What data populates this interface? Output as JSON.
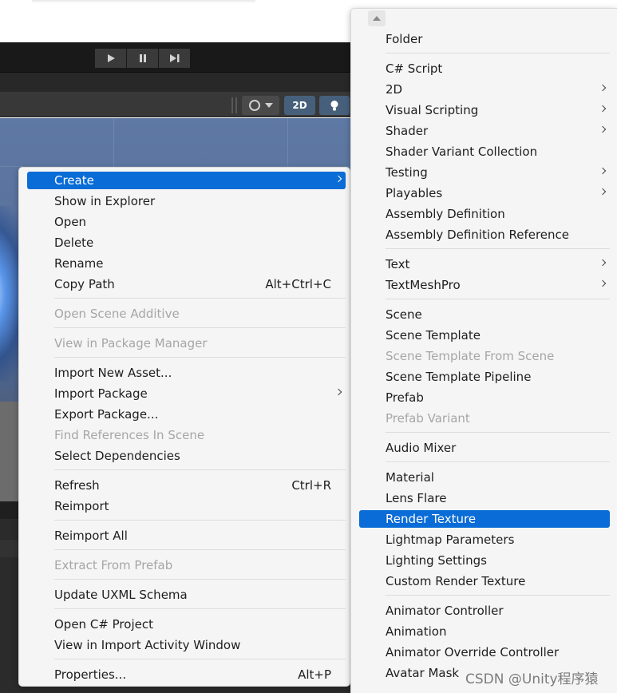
{
  "editor": {
    "play_icon": "play-icon",
    "pause_icon": "pause-icon",
    "step_icon": "step-icon",
    "view_2d_label": "2D",
    "gizmo_icon": "circle-gizmo-icon",
    "light_icon": "lightbulb-icon",
    "accent_color": "#46607c"
  },
  "context_menu": {
    "highlight_color": "#0a6cd6",
    "items": [
      {
        "label": "Create",
        "submenu": true,
        "highlighted": true
      },
      {
        "label": "Show in Explorer"
      },
      {
        "label": "Open"
      },
      {
        "label": "Delete"
      },
      {
        "label": "Rename"
      },
      {
        "label": "Copy Path",
        "shortcut": "Alt+Ctrl+C"
      },
      {
        "label": "Open Scene Additive",
        "disabled": true
      },
      {
        "label": "View in Package Manager",
        "disabled": true
      },
      {
        "label": "Import New Asset..."
      },
      {
        "label": "Import Package",
        "submenu": true
      },
      {
        "label": "Export Package..."
      },
      {
        "label": "Find References In Scene",
        "disabled": true
      },
      {
        "label": "Select Dependencies"
      },
      {
        "label": "Refresh",
        "shortcut": "Ctrl+R"
      },
      {
        "label": "Reimport"
      },
      {
        "label": "Reimport All"
      },
      {
        "label": "Extract From Prefab",
        "disabled": true
      },
      {
        "label": "Update UXML Schema"
      },
      {
        "label": "Open C# Project"
      },
      {
        "label": "View in Import Activity Window"
      },
      {
        "label": "Properties...",
        "shortcut": "Alt+P"
      }
    ]
  },
  "create_submenu": {
    "scroll_up_icon": "scroll-up-arrow-icon",
    "items": [
      {
        "label": "Folder"
      },
      {
        "label": "C# Script"
      },
      {
        "label": "2D",
        "submenu": true
      },
      {
        "label": "Visual Scripting",
        "submenu": true
      },
      {
        "label": "Shader",
        "submenu": true
      },
      {
        "label": "Shader Variant Collection"
      },
      {
        "label": "Testing",
        "submenu": true
      },
      {
        "label": "Playables",
        "submenu": true
      },
      {
        "label": "Assembly Definition"
      },
      {
        "label": "Assembly Definition Reference"
      },
      {
        "label": "Text",
        "submenu": true
      },
      {
        "label": "TextMeshPro",
        "submenu": true
      },
      {
        "label": "Scene"
      },
      {
        "label": "Scene Template"
      },
      {
        "label": "Scene Template From Scene",
        "disabled": true
      },
      {
        "label": "Scene Template Pipeline"
      },
      {
        "label": "Prefab"
      },
      {
        "label": "Prefab Variant",
        "disabled": true
      },
      {
        "label": "Audio Mixer"
      },
      {
        "label": "Material"
      },
      {
        "label": "Lens Flare"
      },
      {
        "label": "Render Texture",
        "highlighted": true
      },
      {
        "label": "Lightmap Parameters"
      },
      {
        "label": "Lighting Settings"
      },
      {
        "label": "Custom Render Texture"
      },
      {
        "label": "Animator Controller"
      },
      {
        "label": "Animation"
      },
      {
        "label": "Animator Override Controller"
      },
      {
        "label": "Avatar Mask"
      }
    ]
  },
  "watermark": "CSDN @Unity程序猿"
}
